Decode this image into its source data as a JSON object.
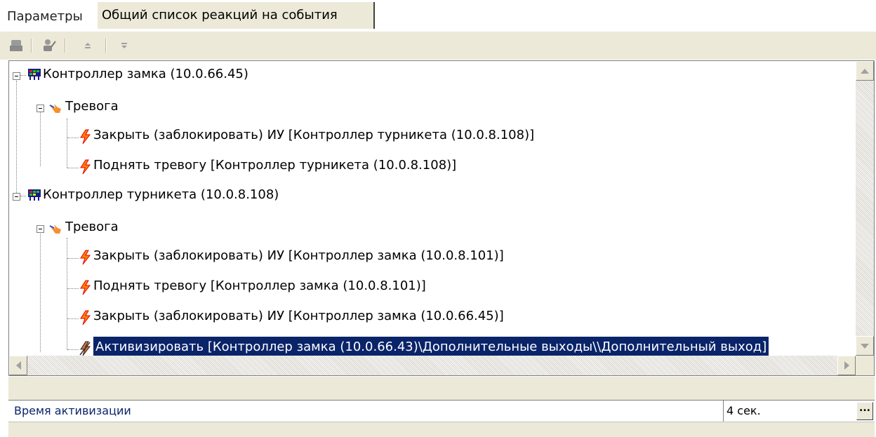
{
  "tabs": [
    {
      "label": "Параметры",
      "active": false
    },
    {
      "label": "Общий список реакций на события",
      "active": true
    }
  ],
  "toolbar": {
    "buttons": [
      {
        "icon": "add-device-icon",
        "enabled": false
      },
      {
        "icon": "edit-user-icon",
        "enabled": false
      },
      {
        "icon": "move-up-icon",
        "enabled": false
      },
      {
        "icon": "move-down-icon",
        "enabled": false
      }
    ]
  },
  "tree": {
    "controller1": {
      "label": "Контроллер замка (10.0.66.45)",
      "icon": "controller-icon",
      "event": {
        "label": "Тревога",
        "icon": "alarm-hand-icon",
        "reactions": [
          {
            "label": "Закрыть (заблокировать) ИУ [Контроллер турникета (10.0.8.108)]",
            "icon": "lightning-icon"
          },
          {
            "label": "Поднять тревогу [Контроллер турникета (10.0.8.108)]",
            "icon": "lightning-icon"
          }
        ]
      }
    },
    "controller2": {
      "label": "Контроллер турникета (10.0.8.108)",
      "icon": "controller-icon",
      "event": {
        "label": "Тревога",
        "icon": "alarm-hand-icon",
        "reactions": [
          {
            "label": "Закрыть (заблокировать) ИУ [Контроллер замка (10.0.8.101)]",
            "icon": "lightning-icon"
          },
          {
            "label": "Поднять тревогу [Контроллер замка (10.0.8.101)]",
            "icon": "lightning-icon"
          },
          {
            "label": "Закрыть (заблокировать) ИУ [Контроллер замка (10.0.66.45)]",
            "icon": "lightning-icon"
          },
          {
            "label": "Активизировать [Контроллер замка (10.0.66.43)\\Дополнительные выходы\\\\Дополнительный выход]",
            "icon": "lightning-selected-icon",
            "selected": true
          }
        ]
      }
    }
  },
  "property": {
    "name": "Время активизации",
    "value": "4 сек.",
    "button_label": "..."
  },
  "colors": {
    "selection": "#0a246a",
    "toolbar": "#ece9d8",
    "lightning_orange": "#ff8000",
    "lightning_red": "#e00000"
  }
}
